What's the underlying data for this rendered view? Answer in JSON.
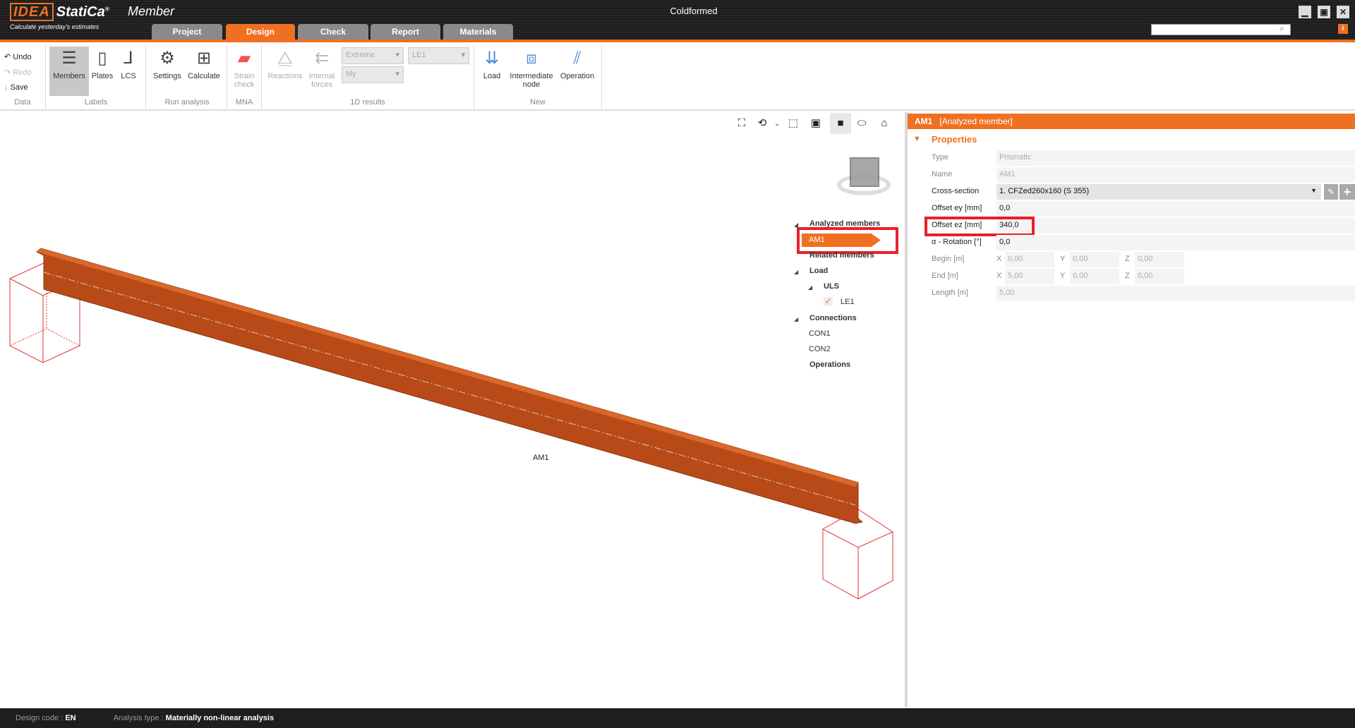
{
  "app": {
    "logo": "IDEA StatiCa",
    "product": "Member",
    "tagline": "Calculate yesterday's estimates",
    "window_title": "Coldformed",
    "search_placeholder": "",
    "minimize": "▁",
    "maximize": "▣",
    "close": "✕",
    "info": "i"
  },
  "tabs": [
    {
      "label": "Project"
    },
    {
      "label": "Design",
      "active": true
    },
    {
      "label": "Check"
    },
    {
      "label": "Report"
    },
    {
      "label": "Materials"
    }
  ],
  "ribbon": {
    "data": {
      "undo": "Undo",
      "redo": "Redo",
      "save": "Save",
      "group": "Data"
    },
    "labels": {
      "members": "Members",
      "plates": "Plates",
      "lcs": "LCS",
      "group": "Labels"
    },
    "run": {
      "settings": "Settings",
      "calculate": "Calculate",
      "group": "Run analysis"
    },
    "mna": {
      "strain_check": "Strain check",
      "group": "MNA"
    },
    "results": {
      "reactions": "Reactions",
      "internal_forces": "Internal forces",
      "extreme": "Extreme",
      "my": "My",
      "le": "LE1",
      "group": "1D results"
    },
    "new": {
      "load": "Load",
      "intermediate_node": "Intermediate node",
      "operation": "Operation",
      "group": "New"
    }
  },
  "viewport": {
    "member_label": "AM1"
  },
  "tree": {
    "analyzed_members": "Analyzed members",
    "am1": "AM1",
    "related_members": "Related members",
    "load": "Load",
    "uls": "ULS",
    "le1": "LE1",
    "connections": "Connections",
    "con1": "CON1",
    "con2": "CON2",
    "operations": "Operations"
  },
  "panel": {
    "title": "AM1",
    "subtitle": "[Analyzed member]",
    "section": "Properties",
    "type": {
      "label": "Type",
      "value": "Prismatic"
    },
    "name": {
      "label": "Name",
      "value": "AM1"
    },
    "cross_section": {
      "label": "Cross-section",
      "value": "1. CFZed260x160 (S 355)"
    },
    "offset_ey": {
      "label": "Offset ey [mm]",
      "value": "0,0"
    },
    "offset_ez": {
      "label": "Offset ez [mm]",
      "value": "340,0"
    },
    "rotation": {
      "label": "α - Rotation [°]",
      "value": "0,0"
    },
    "begin": {
      "label": "Begin [m]",
      "x": "0,00",
      "y": "0,00",
      "z": "0,00"
    },
    "end": {
      "label": "End [m]",
      "x": "5,00",
      "y": "0,00",
      "z": "0,00"
    },
    "length": {
      "label": "Length [m]",
      "value": "5,00"
    },
    "axis_x": "X",
    "axis_y": "Y",
    "axis_z": "Z"
  },
  "status": {
    "design_code_label": "Design code :",
    "design_code": "EN",
    "analysis_label": "Analysis type :",
    "analysis": "Materially non-linear analysis"
  },
  "colors": {
    "accent": "#f07022",
    "beam": "#b84a18",
    "highlight": "#e8202a"
  }
}
